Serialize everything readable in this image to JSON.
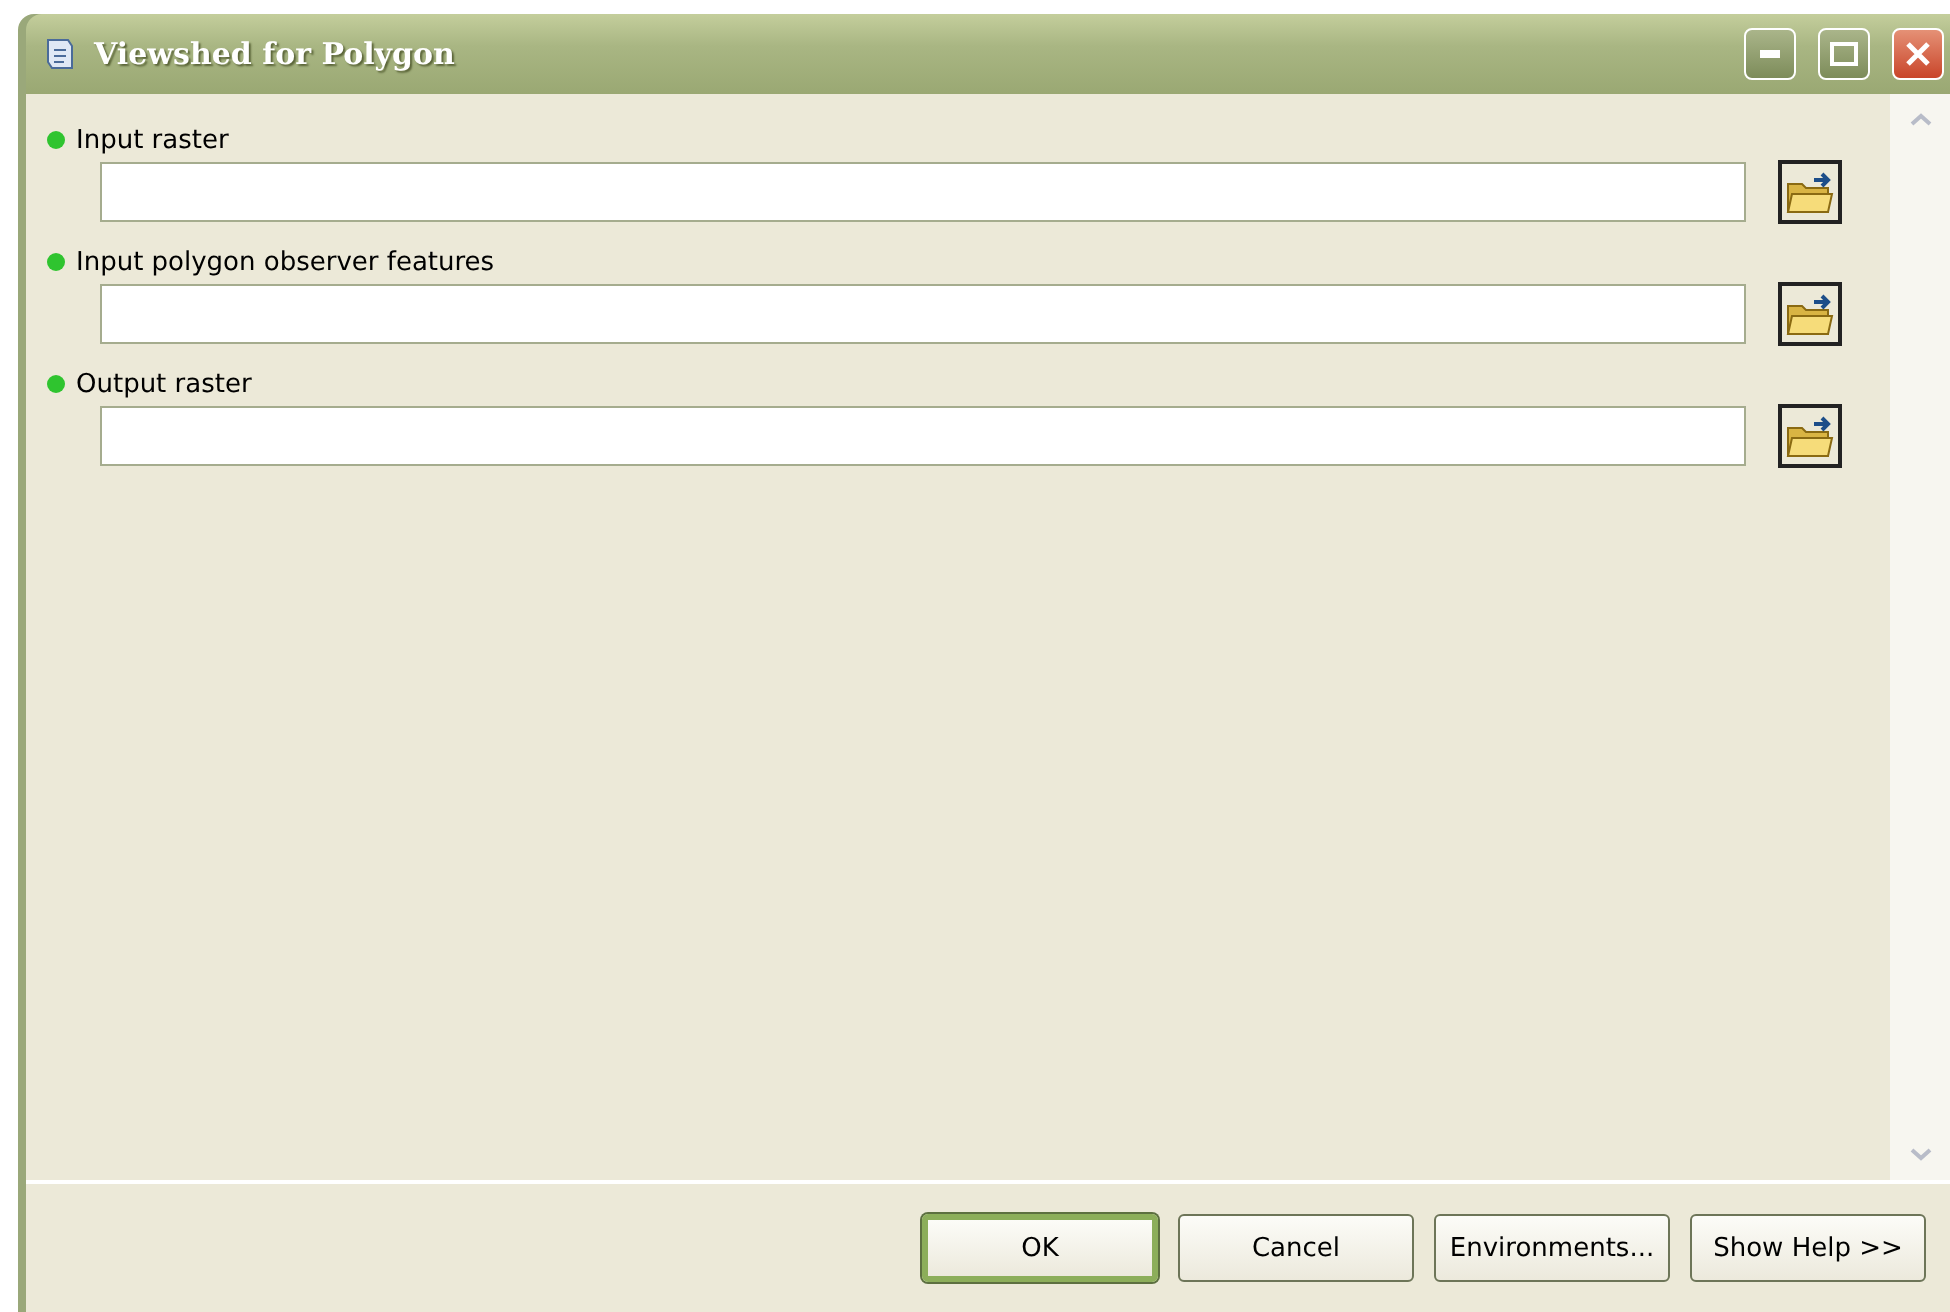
{
  "window": {
    "title": "Viewshed for Polygon"
  },
  "parameters": [
    {
      "label": "Input raster",
      "required": true
    },
    {
      "label": "Input polygon observer features",
      "required": true
    },
    {
      "label": "Output raster",
      "required": true
    }
  ],
  "buttons": [
    {
      "label": "OK",
      "default": true
    },
    {
      "label": "Cancel",
      "default": false
    },
    {
      "label": "Environments...",
      "default": false
    },
    {
      "label": "Show Help >>",
      "default": false
    }
  ]
}
